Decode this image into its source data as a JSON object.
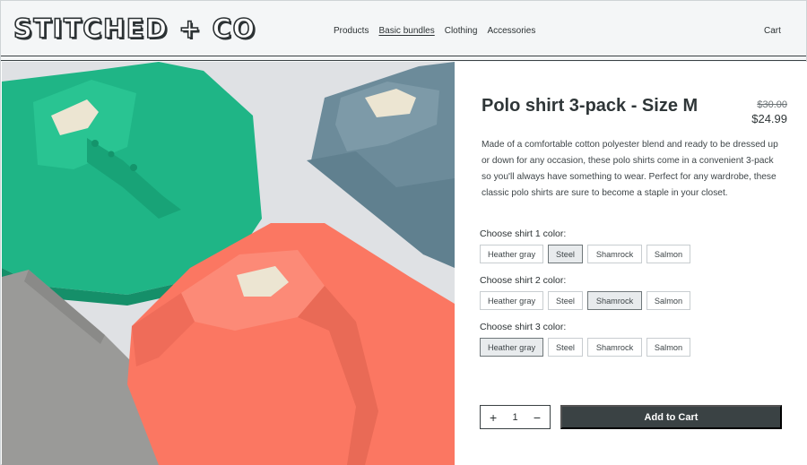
{
  "brand": {
    "logo_text": "STITCHED + CO"
  },
  "nav": {
    "items": [
      {
        "label": "Products",
        "active": false
      },
      {
        "label": "Basic bundles",
        "active": true
      },
      {
        "label": "Clothing",
        "active": false
      },
      {
        "label": "Accessories",
        "active": false
      }
    ],
    "cart_label": "Cart"
  },
  "product": {
    "title": "Polo shirt 3-pack - Size M",
    "price_original": "$30.00",
    "price_sale": "$24.99",
    "description": "Made of a comfortable cotton polyester blend and ready to be dressed up or down for any occasion, these polo shirts come in a convenient 3-pack so you'll always have something to wear. Perfect for any wardrobe, these classic polo shirts are sure to become a staple in your closet.",
    "image_alt": "Folded polo shirts in shamrock, steel, salmon and heather gray"
  },
  "color_options": [
    "Heather gray",
    "Steel",
    "Shamrock",
    "Salmon"
  ],
  "color_groups": [
    {
      "label": "Choose shirt 1 color:",
      "selected": "Steel"
    },
    {
      "label": "Choose shirt 2 color:",
      "selected": "Shamrock"
    },
    {
      "label": "Choose shirt 3 color:",
      "selected": "Heather gray"
    }
  ],
  "quantity": {
    "increment_symbol": "+",
    "value": "1",
    "decrement_symbol": "−"
  },
  "add_to_cart_label": "Add to Cart",
  "colors": {
    "shamrock": "#1fb586",
    "steel": "#6f8d9c",
    "salmon": "#fb7762",
    "heather_gray": "#9a9a98",
    "dark": "#3a4244"
  }
}
